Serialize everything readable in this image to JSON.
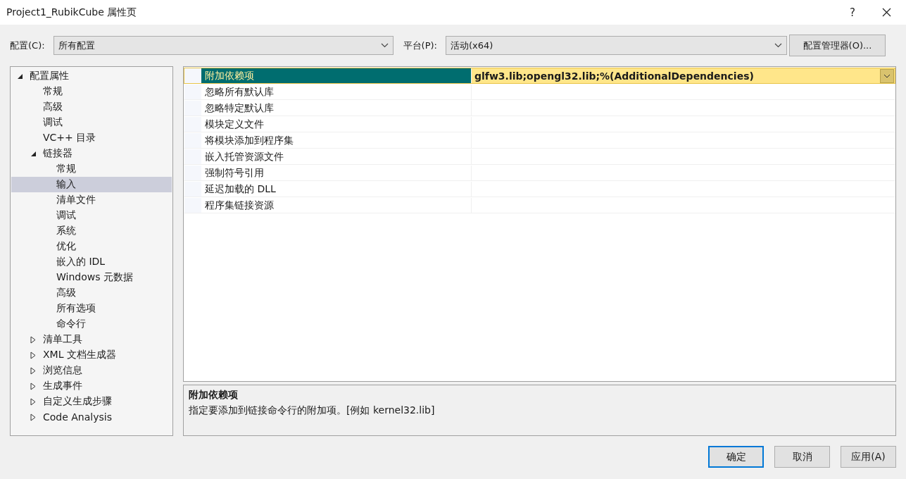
{
  "window": {
    "title": "Project1_RubikCube 属性页",
    "help": "?"
  },
  "config": {
    "label": "配置(C):",
    "value": "所有配置"
  },
  "platform": {
    "label": "平台(P):",
    "value": "活动(x64)"
  },
  "config_manager_button": "配置管理器(O)...",
  "tree": [
    {
      "label": "配置属性",
      "expanded": true,
      "selected": false,
      "children": [
        {
          "label": "常规",
          "selected": false
        },
        {
          "label": "高级",
          "selected": false
        },
        {
          "label": "调试",
          "selected": false
        },
        {
          "label": "VC++ 目录",
          "selected": false
        },
        {
          "label": "链接器",
          "expanded": true,
          "selected": false,
          "children": [
            {
              "label": "常规",
              "selected": false
            },
            {
              "label": "输入",
              "selected": true
            },
            {
              "label": "清单文件",
              "selected": false
            },
            {
              "label": "调试",
              "selected": false
            },
            {
              "label": "系统",
              "selected": false
            },
            {
              "label": "优化",
              "selected": false
            },
            {
              "label": "嵌入的 IDL",
              "selected": false
            },
            {
              "label": "Windows 元数据",
              "selected": false
            },
            {
              "label": "高级",
              "selected": false
            },
            {
              "label": "所有选项",
              "selected": false
            },
            {
              "label": "命令行",
              "selected": false
            }
          ]
        },
        {
          "label": "清单工具",
          "expanded": false,
          "selected": false
        },
        {
          "label": "XML 文档生成器",
          "expanded": false,
          "selected": false
        },
        {
          "label": "浏览信息",
          "expanded": false,
          "selected": false
        },
        {
          "label": "生成事件",
          "expanded": false,
          "selected": false
        },
        {
          "label": "自定义生成步骤",
          "expanded": false,
          "selected": false
        },
        {
          "label": "Code Analysis",
          "expanded": false,
          "selected": false
        }
      ]
    }
  ],
  "properties": [
    {
      "name": "附加依赖项",
      "value": "glfw3.lib;opengl32.lib;%(AdditionalDependencies)",
      "selected": true
    },
    {
      "name": "忽略所有默认库",
      "selected": false
    },
    {
      "name": "忽略特定默认库",
      "selected": false
    },
    {
      "name": "模块定义文件",
      "selected": false
    },
    {
      "name": "将模块添加到程序集",
      "selected": false
    },
    {
      "name": "嵌入托管资源文件",
      "selected": false
    },
    {
      "name": "强制符号引用",
      "selected": false
    },
    {
      "name": "延迟加载的 DLL",
      "selected": false
    },
    {
      "name": "程序集链接资源",
      "selected": false
    }
  ],
  "description": {
    "title": "附加依赖项",
    "text": "指定要添加到链接命令行的附加项。[例如 kernel32.lib]"
  },
  "buttons": [
    {
      "label": "确定",
      "kind": "default"
    },
    {
      "label": "取消",
      "kind": "normal"
    },
    {
      "label": "应用(A)",
      "kind": "normal"
    }
  ]
}
